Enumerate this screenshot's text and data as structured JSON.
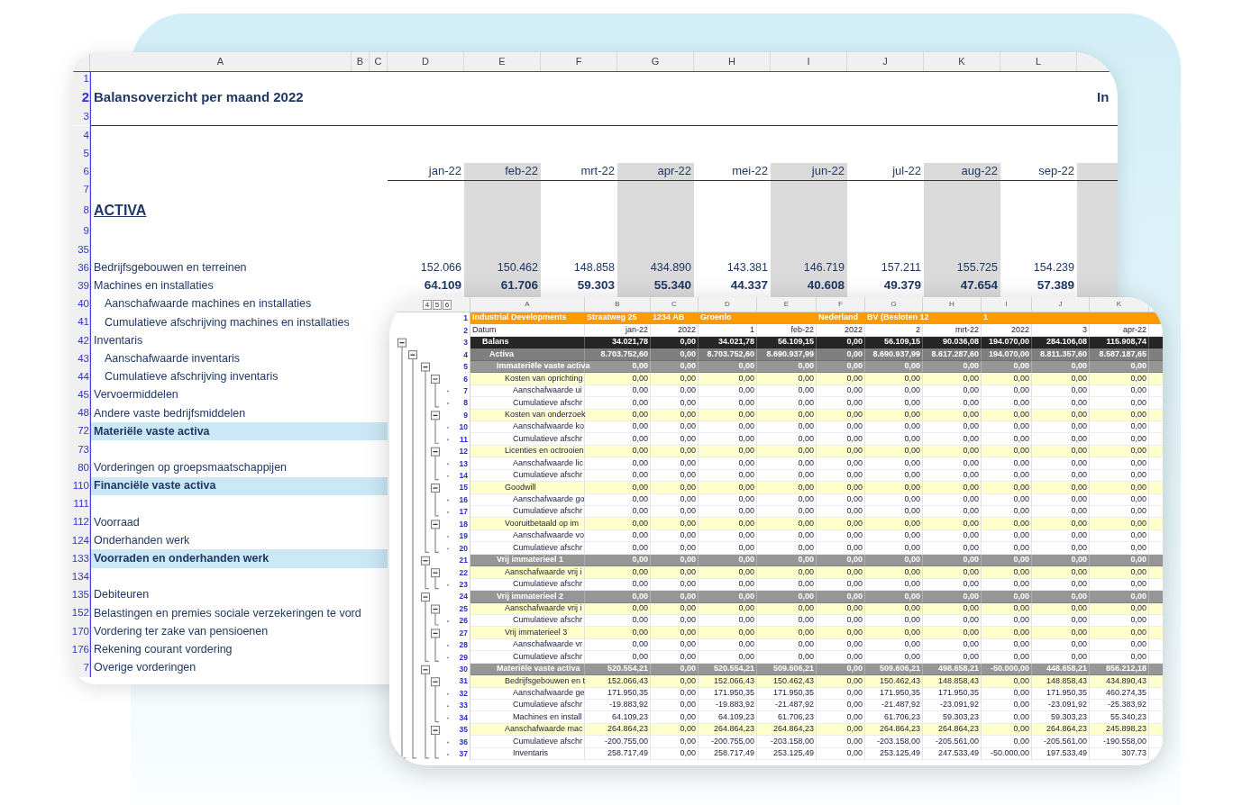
{
  "back_sheet": {
    "columns": [
      "A",
      "B",
      "C",
      "D",
      "E",
      "F",
      "G",
      "H",
      "I",
      "J",
      "K",
      "L"
    ],
    "rows": [
      {
        "n": "1",
        "kind": "blank"
      },
      {
        "n": "2",
        "kind": "title",
        "label": "Balansoverzicht per maand 2022",
        "side_title": "In"
      },
      {
        "n": "3",
        "kind": "blank"
      },
      {
        "n": "4",
        "kind": "blank"
      },
      {
        "n": "5",
        "kind": "blank"
      },
      {
        "n": "6",
        "kind": "months",
        "values": [
          "jan-22",
          "feb-22",
          "mrt-22",
          "apr-22",
          "mei-22",
          "jun-22",
          "jul-22",
          "aug-22",
          "sep-22"
        ]
      },
      {
        "n": "7",
        "kind": "blank"
      },
      {
        "n": "8",
        "kind": "heading",
        "label": "ACTIVA"
      },
      {
        "n": "9",
        "kind": "blank"
      },
      {
        "n": "35",
        "kind": "blank"
      },
      {
        "n": "36",
        "kind": "item",
        "label": "Bedrijfsgebouwen en terreinen",
        "values": [
          "152.066",
          "150.462",
          "148.858",
          "434.890",
          "143.381",
          "146.719",
          "157.211",
          "155.725",
          "154.239"
        ]
      },
      {
        "n": "39",
        "kind": "sum",
        "label": "Machines en installaties",
        "values": [
          "64.109",
          "61.706",
          "59.303",
          "55.340",
          "44.337",
          "40.608",
          "49.379",
          "47.654",
          "57.389"
        ]
      },
      {
        "n": "40",
        "kind": "subitem",
        "label": "Aanschafwaarde machines en installaties"
      },
      {
        "n": "41",
        "kind": "subitem",
        "label": "Cumulatieve afschrijving machines en installaties"
      },
      {
        "n": "42",
        "kind": "item",
        "label": "Inventaris"
      },
      {
        "n": "43",
        "kind": "subitem",
        "label": "Aanschafwaarde inventaris"
      },
      {
        "n": "44",
        "kind": "subitem",
        "label": "Cumulatieve afschrijving inventaris"
      },
      {
        "n": "45",
        "kind": "item",
        "label": "Vervoermiddelen"
      },
      {
        "n": "48",
        "kind": "item",
        "label": "Andere vaste bedrijfsmiddelen"
      },
      {
        "n": "72",
        "kind": "total",
        "label": "Materiële vaste activa"
      },
      {
        "n": "73",
        "kind": "blank"
      },
      {
        "n": "80",
        "kind": "item",
        "label": "Vorderingen op groepsmaatschappijen"
      },
      {
        "n": "110",
        "kind": "total",
        "label": "Financiële vaste activa"
      },
      {
        "n": "111",
        "kind": "blank"
      },
      {
        "n": "112",
        "kind": "item",
        "label": "Voorraad"
      },
      {
        "n": "124",
        "kind": "item",
        "label": "Onderhanden werk"
      },
      {
        "n": "133",
        "kind": "total",
        "label": "Voorraden en onderhanden werk"
      },
      {
        "n": "134",
        "kind": "blank"
      },
      {
        "n": "135",
        "kind": "item",
        "label": "Debiteuren"
      },
      {
        "n": "152",
        "kind": "item",
        "label": "Belastingen en premies sociale verzekeringen te vord"
      },
      {
        "n": "170",
        "kind": "item",
        "label": "Vordering ter zake van pensioenen"
      },
      {
        "n": "176",
        "kind": "item",
        "label": "Rekening courant vordering"
      },
      {
        "n": "7",
        "kind": "item",
        "label": "Overige vorderingen"
      }
    ]
  },
  "front_sheet": {
    "outline_levels": [
      "4",
      "5",
      "6"
    ],
    "columns": [
      "A",
      "B",
      "C",
      "D",
      "E",
      "F",
      "G",
      "H",
      "I",
      "J",
      "K"
    ],
    "banner": {
      "n": "1",
      "texts": [
        "Industrial Developments",
        "Straatweg 25",
        "1234 AB",
        "Groenlo",
        "Nederland",
        "BV (Besloten 12",
        "1"
      ]
    },
    "dates": {
      "n": "2",
      "cells": [
        "Datum",
        "jan-22",
        "2022",
        "1",
        "feb-22",
        "2022",
        "2",
        "mrt-22",
        "2022",
        "3",
        "apr-22"
      ]
    },
    "tree": [
      {
        "n": "3",
        "label": "Balans",
        "values": [
          "34.021,78",
          "0,00",
          "34.021,78",
          "56.109,15",
          "0,00",
          "56.109,15",
          "90.036,08",
          "194.070,00",
          "284.106,08",
          "115.908,74"
        ],
        "children": [
          {
            "n": "4",
            "label": "Activa",
            "values": [
              "8.703.752,60",
              "0,00",
              "8.703.752,60",
              "8.690.937,99",
              "0,00",
              "8.690.937,99",
              "8.617.287,60",
              "194.070,00",
              "8.811.357,60",
              "8.587.187,65"
            ],
            "children": [
              {
                "n": "5",
                "label": "Immateriële vaste activa",
                "values": [
                  "0,00",
                  "0,00",
                  "0,00",
                  "0,00",
                  "0,00",
                  "0,00",
                  "0,00",
                  "0,00",
                  "0,00",
                  "0,00"
                ],
                "children": [
                  {
                    "n": "6",
                    "label": "Kosten van oprichting",
                    "values": [
                      "0,00",
                      "0,00",
                      "0,00",
                      "0,00",
                      "0,00",
                      "0,00",
                      "0,00",
                      "0,00",
                      "0,00",
                      "0,00"
                    ],
                    "children": [
                      {
                        "n": "7",
                        "label": "Aanschafwaarde ui",
                        "values": [
                          "0,00",
                          "0,00",
                          "0,00",
                          "0,00",
                          "0,00",
                          "0,00",
                          "0,00",
                          "0,00",
                          "0,00",
                          "0,00"
                        ]
                      },
                      {
                        "n": "8",
                        "label": "Cumulatieve afschr",
                        "values": [
                          "0,00",
                          "0,00",
                          "0,00",
                          "0,00",
                          "0,00",
                          "0,00",
                          "0,00",
                          "0,00",
                          "0,00",
                          "0,00"
                        ]
                      }
                    ]
                  },
                  {
                    "n": "9",
                    "label": "Kosten van onderzoek",
                    "values": [
                      "0,00",
                      "0,00",
                      "0,00",
                      "0,00",
                      "0,00",
                      "0,00",
                      "0,00",
                      "0,00",
                      "0,00",
                      "0,00"
                    ],
                    "children": [
                      {
                        "n": "10",
                        "label": "Aanschafwaarde ko",
                        "values": [
                          "0,00",
                          "0,00",
                          "0,00",
                          "0,00",
                          "0,00",
                          "0,00",
                          "0,00",
                          "0,00",
                          "0,00",
                          "0,00"
                        ]
                      },
                      {
                        "n": "11",
                        "label": "Cumulatieve afschr",
                        "values": [
                          "0,00",
                          "0,00",
                          "0,00",
                          "0,00",
                          "0,00",
                          "0,00",
                          "0,00",
                          "0,00",
                          "0,00",
                          "0,00"
                        ]
                      }
                    ]
                  },
                  {
                    "n": "12",
                    "label": "Licenties en octrooien",
                    "values": [
                      "0,00",
                      "0,00",
                      "0,00",
                      "0,00",
                      "0,00",
                      "0,00",
                      "0,00",
                      "0,00",
                      "0,00",
                      "0,00"
                    ],
                    "children": [
                      {
                        "n": "13",
                        "label": "Aanschafwaarde lic",
                        "values": [
                          "0,00",
                          "0,00",
                          "0,00",
                          "0,00",
                          "0,00",
                          "0,00",
                          "0,00",
                          "0,00",
                          "0,00",
                          "0,00"
                        ]
                      },
                      {
                        "n": "14",
                        "label": "Cumulatieve afschr",
                        "values": [
                          "0,00",
                          "0,00",
                          "0,00",
                          "0,00",
                          "0,00",
                          "0,00",
                          "0,00",
                          "0,00",
                          "0,00",
                          "0,00"
                        ]
                      }
                    ]
                  },
                  {
                    "n": "15",
                    "label": "Goodwill",
                    "values": [
                      "0,00",
                      "0,00",
                      "0,00",
                      "0,00",
                      "0,00",
                      "0,00",
                      "0,00",
                      "0,00",
                      "0,00",
                      "0,00"
                    ],
                    "children": [
                      {
                        "n": "16",
                        "label": "Aanschafwaarde go",
                        "values": [
                          "0,00",
                          "0,00",
                          "0,00",
                          "0,00",
                          "0,00",
                          "0,00",
                          "0,00",
                          "0,00",
                          "0,00",
                          "0,00"
                        ]
                      },
                      {
                        "n": "17",
                        "label": "Cumulatieve afschr",
                        "values": [
                          "0,00",
                          "0,00",
                          "0,00",
                          "0,00",
                          "0,00",
                          "0,00",
                          "0,00",
                          "0,00",
                          "0,00",
                          "0,00"
                        ]
                      }
                    ]
                  },
                  {
                    "n": "18",
                    "label": "Vooruitbetaald op im",
                    "values": [
                      "0,00",
                      "0,00",
                      "0,00",
                      "0,00",
                      "0,00",
                      "0,00",
                      "0,00",
                      "0,00",
                      "0,00",
                      "0,00"
                    ],
                    "children": [
                      {
                        "n": "19",
                        "label": "Aanschafwaarde vo",
                        "values": [
                          "0,00",
                          "0,00",
                          "0,00",
                          "0,00",
                          "0,00",
                          "0,00",
                          "0,00",
                          "0,00",
                          "0,00",
                          "0,00"
                        ]
                      },
                      {
                        "n": "20",
                        "label": "Cumulatieve afschr",
                        "values": [
                          "0,00",
                          "0,00",
                          "0,00",
                          "0,00",
                          "0,00",
                          "0,00",
                          "0,00",
                          "0,00",
                          "0,00",
                          "0,00"
                        ]
                      }
                    ]
                  }
                ]
              },
              {
                "n": "21",
                "label": "Vrij immaterieel 1",
                "values": [
                  "0,00",
                  "0,00",
                  "0,00",
                  "0,00",
                  "0,00",
                  "0,00",
                  "0,00",
                  "0,00",
                  "0,00",
                  "0,00"
                ],
                "children": [
                  {
                    "n": "22",
                    "label": "Aanschafwaarde vrij i",
                    "values": [
                      "0,00",
                      "0,00",
                      "0,00",
                      "0,00",
                      "0,00",
                      "0,00",
                      "0,00",
                      "0,00",
                      "0,00",
                      "0,00"
                    ],
                    "children": [
                      {
                        "n": "23",
                        "label": "Cumulatieve afschr",
                        "values": [
                          "0,00",
                          "0,00",
                          "0,00",
                          "0,00",
                          "0,00",
                          "0,00",
                          "0,00",
                          "0,00",
                          "0,00",
                          "0,00"
                        ]
                      }
                    ]
                  }
                ]
              },
              {
                "n": "24",
                "label": "Vrij immaterieel 2",
                "values": [
                  "0,00",
                  "0,00",
                  "0,00",
                  "0,00",
                  "0,00",
                  "0,00",
                  "0,00",
                  "0,00",
                  "0,00",
                  "0,00"
                ],
                "children": [
                  {
                    "n": "25",
                    "label": "Aanschafwaarde vrij i",
                    "values": [
                      "0,00",
                      "0,00",
                      "0,00",
                      "0,00",
                      "0,00",
                      "0,00",
                      "0,00",
                      "0,00",
                      "0,00",
                      "0,00"
                    ],
                    "children": [
                      {
                        "n": "26",
                        "label": "Cumulatieve afschr",
                        "values": [
                          "0,00",
                          "0,00",
                          "0,00",
                          "0,00",
                          "0,00",
                          "0,00",
                          "0,00",
                          "0,00",
                          "0,00",
                          "0,00"
                        ]
                      }
                    ]
                  },
                  {
                    "n": "27",
                    "label": "Vrij immaterieel 3",
                    "values": [
                      "0,00",
                      "0,00",
                      "0,00",
                      "0,00",
                      "0,00",
                      "0,00",
                      "0,00",
                      "0,00",
                      "0,00",
                      "0,00"
                    ],
                    "children": [
                      {
                        "n": "28",
                        "label": "Aanschafwaarde vr",
                        "values": [
                          "0,00",
                          "0,00",
                          "0,00",
                          "0,00",
                          "0,00",
                          "0,00",
                          "0,00",
                          "0,00",
                          "0,00",
                          "0,00"
                        ]
                      },
                      {
                        "n": "29",
                        "label": "Cumulatieve afschr",
                        "values": [
                          "0,00",
                          "0,00",
                          "0,00",
                          "0,00",
                          "0,00",
                          "0,00",
                          "0,00",
                          "0,00",
                          "0,00",
                          "0,00"
                        ]
                      }
                    ]
                  }
                ]
              },
              {
                "n": "30",
                "label": "Materiële vaste activa",
                "values": [
                  "520.554,21",
                  "0,00",
                  "520.554,21",
                  "509.606,21",
                  "0,00",
                  "509.606,21",
                  "498.658,21",
                  "-50.000,00",
                  "448.658,21",
                  "856.212,18"
                ],
                "children": [
                  {
                    "n": "31",
                    "label": "Bedrijfsgebouwen en t",
                    "values": [
                      "152.066,43",
                      "0,00",
                      "152.066,43",
                      "150.462,43",
                      "0,00",
                      "150.462,43",
                      "148.858,43",
                      "0,00",
                      "148.858,43",
                      "434.890,43"
                    ],
                    "children": [
                      {
                        "n": "32",
                        "label": "Aanschafwaarde ge",
                        "values": [
                          "171.950,35",
                          "0,00",
                          "171.950,35",
                          "171.950,35",
                          "0,00",
                          "171.950,35",
                          "171.950,35",
                          "0,00",
                          "171.950,35",
                          "460.274,35"
                        ]
                      },
                      {
                        "n": "33",
                        "label": "Cumulatieve afschr",
                        "values": [
                          "-19.883,92",
                          "0,00",
                          "-19.883,92",
                          "-21.487,92",
                          "0,00",
                          "-21.487,92",
                          "-23.091,92",
                          "0,00",
                          "-23.091,92",
                          "-25.383,92"
                        ]
                      },
                      {
                        "n": "34",
                        "label": "Machines en install",
                        "values": [
                          "64.109,23",
                          "0,00",
                          "64.109,23",
                          "61.706,23",
                          "0,00",
                          "61.706,23",
                          "59.303,23",
                          "0,00",
                          "59.303,23",
                          "55.340,23"
                        ]
                      }
                    ]
                  },
                  {
                    "n": "35",
                    "label": "Aanschafwaarde mac",
                    "values": [
                      "264.864,23",
                      "0,00",
                      "264.864,23",
                      "264.864,23",
                      "0,00",
                      "264.864,23",
                      "264.864,23",
                      "0,00",
                      "264.864,23",
                      "245.898,23"
                    ],
                    "children": [
                      {
                        "n": "36",
                        "label": "Cumulatieve afschr",
                        "values": [
                          "-200.755,00",
                          "0,00",
                          "-200.755,00",
                          "-203.158,00",
                          "0,00",
                          "-203.158,00",
                          "-205.561,00",
                          "0,00",
                          "-205.561,00",
                          "-190.558,00"
                        ]
                      },
                      {
                        "n": "37",
                        "label": "Inventaris",
                        "values": [
                          "258.717,49",
                          "0,00",
                          "258.717,49",
                          "253.125,49",
                          "0,00",
                          "253.125,49",
                          "247.533,49",
                          "-50.000,00",
                          "197.533,49",
                          "307.73"
                        ]
                      }
                    ]
                  }
                ]
              }
            ]
          }
        ]
      }
    ]
  }
}
